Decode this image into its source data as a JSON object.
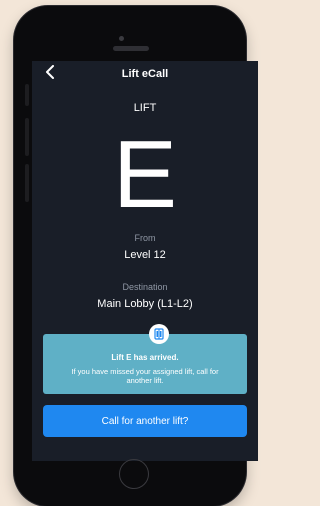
{
  "header": {
    "back_icon": "chevron-left-icon",
    "title": "Lift eCall"
  },
  "lift": {
    "label": "LIFT",
    "letter": "E"
  },
  "from": {
    "label": "From",
    "value": "Level 12"
  },
  "destination": {
    "label": "Destination",
    "value": "Main Lobby (L1-L2)"
  },
  "banner": {
    "icon": "lift-icon",
    "title": "Lift E has arrived.",
    "text": "If you have missed your assigned lift, call for another lift.",
    "color": "#5fb0c6"
  },
  "call_button": {
    "label": "Call for another lift?",
    "color": "#1f88f0"
  },
  "colors": {
    "screen_background": "#191e28",
    "device_frame": "#0b0b0d",
    "page_background": "#f3e6d8"
  }
}
